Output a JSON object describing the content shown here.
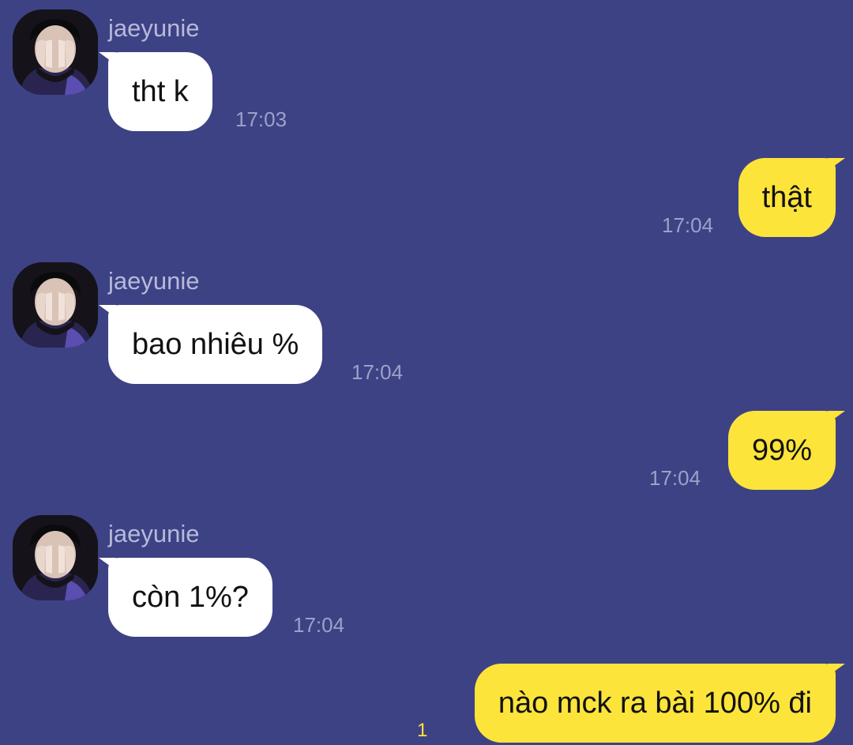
{
  "colors": {
    "background": "#3d4285",
    "incoming_bubble": "#ffffff",
    "outgoing_bubble": "#fce43a",
    "timestamp": "#9da0c8",
    "sender_name": "#b7b9d9",
    "unread_count": "#fce43a"
  },
  "messages": [
    {
      "direction": "incoming",
      "sender": "jaeyunie",
      "avatar_icon": "avatar-photo-icon",
      "text": "tht k",
      "time": "17:03"
    },
    {
      "direction": "outgoing",
      "text": "thật",
      "time": "17:04"
    },
    {
      "direction": "incoming",
      "sender": "jaeyunie",
      "avatar_icon": "avatar-photo-icon",
      "text": "bao nhiêu %",
      "time": "17:04"
    },
    {
      "direction": "outgoing",
      "text": "99%",
      "time": "17:04"
    },
    {
      "direction": "incoming",
      "sender": "jaeyunie",
      "avatar_icon": "avatar-photo-icon",
      "text": "còn 1%?",
      "time": "17:04"
    },
    {
      "direction": "outgoing",
      "text": "nào mck ra bài 100% đi",
      "unread": "1"
    }
  ]
}
